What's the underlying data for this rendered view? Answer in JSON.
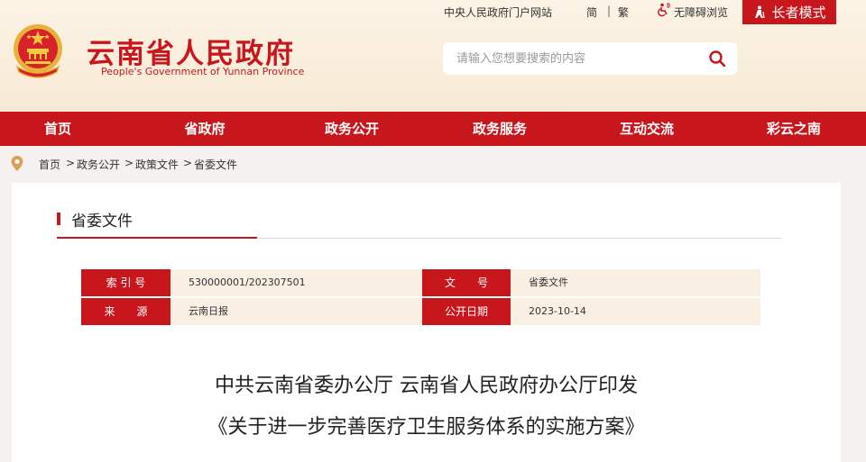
{
  "header": {
    "title": "云南省人民政府",
    "subtitle": "People's Government of Yunnan Province",
    "top_links": {
      "central_portal": "中央人民政府门户网站",
      "simplified": "简",
      "separator": "|",
      "traditional": "繁",
      "accessibility": "无障碍浏览",
      "elder_mode": "长者模式"
    },
    "search": {
      "placeholder": "请输入您想要搜索的内容"
    }
  },
  "nav": {
    "items": [
      {
        "label": "首页"
      },
      {
        "label": "省政府"
      },
      {
        "label": "政务公开"
      },
      {
        "label": "政务服务"
      },
      {
        "label": "互动交流"
      },
      {
        "label": "彩云之南"
      }
    ]
  },
  "breadcrumb": {
    "items": [
      "首页",
      "政务公开",
      "政策文件",
      "省委文件"
    ],
    "separator": ">"
  },
  "section": {
    "title": "省委文件"
  },
  "meta": {
    "index_label": "索 引 号",
    "index_value": "530000001/202307501",
    "doc_no_label": "文　　号",
    "doc_no_value": "省委文件",
    "source_label": "来　　源",
    "source_value": "云南日报",
    "date_label": "公开日期",
    "date_value": "2023-10-14"
  },
  "document": {
    "title_line1": "中共云南省委办公厅 云南省人民政府办公厅印发",
    "title_line2": "《关于进一步完善医疗卫生服务体系的实施方案》"
  },
  "colors": {
    "brand_red": "#c8161d",
    "header_bg": "#fbf3e6",
    "meta_value_bg": "#f9f0e3",
    "page_bg": "#f4f1ee"
  }
}
